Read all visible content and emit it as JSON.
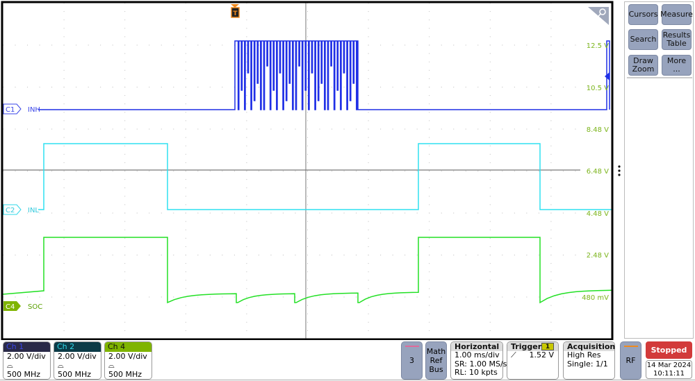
{
  "channels": [
    {
      "tag": "C1",
      "name": "INH",
      "color": "#1f2fe6"
    },
    {
      "tag": "C2",
      "name": "INL",
      "color": "#2fe0f0"
    },
    {
      "tag": "C4",
      "name": "SOC",
      "color": "#22e024"
    }
  ],
  "scale_labels": [
    "12.5 V",
    "10.5 V",
    "8.48 V",
    "6.48 V",
    "4.48 V",
    "2.48 V",
    "480 mV"
  ],
  "scale_color": "#7cb51c",
  "trigger_marker": "T",
  "side_buttons": [
    "Cursors",
    "Measure",
    "Search",
    "Results Table",
    "Draw Zoom",
    "More ..."
  ],
  "channel_badges": [
    {
      "label": "Ch 1",
      "scale": "2.00 V/div",
      "bandwidth": "500 MHz",
      "header_color": "#2a2a48",
      "text_color": "#3a46e8"
    },
    {
      "label": "Ch 2",
      "scale": "2.00 V/div",
      "bandwidth": "500 MHz",
      "header_color": "#0c3b47",
      "text_color": "#2fd8ea"
    },
    {
      "label": "Ch 4",
      "scale": "2.00 V/div",
      "bandwidth": "500 MHz",
      "header_color": "#7fb400",
      "text_color": "#111111"
    }
  ],
  "extra_channel": "3",
  "math_ref_bus": "Math Ref Bus",
  "horizontal": {
    "title": "Horizontal",
    "scale": "1.00 ms/div",
    "sr": "SR: 1.00 MS/s",
    "rl": "RL: 10 kpts"
  },
  "trigger": {
    "title": "Trigger",
    "source": "1",
    "slope": "rising",
    "level": "1.52 V"
  },
  "acquisition": {
    "title": "Acquisition",
    "mode": "High Res",
    "count": "Single: 1/1"
  },
  "rf": "RF",
  "run_state": "Stopped",
  "date": "14 Mar 2024",
  "time": "10:11:11"
}
